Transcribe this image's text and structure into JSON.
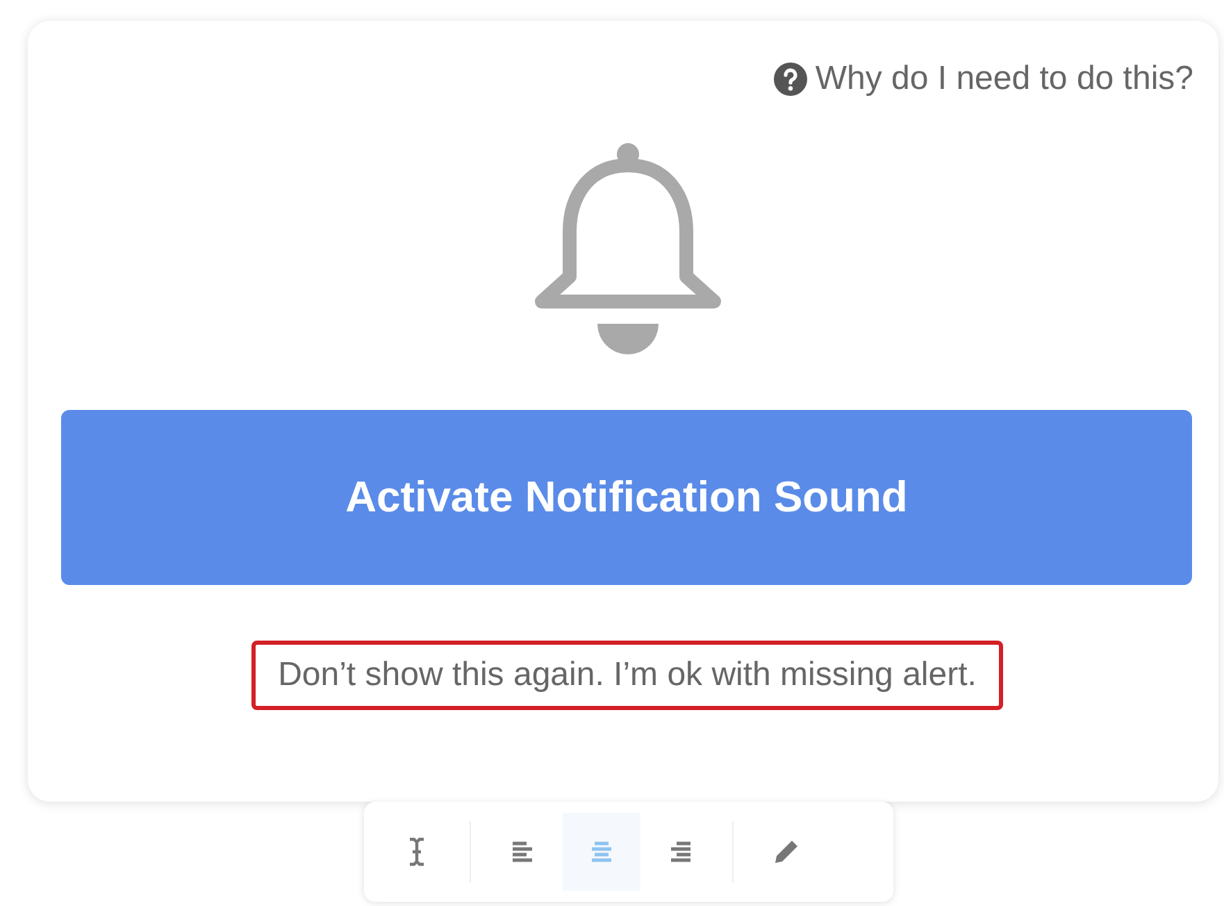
{
  "dialog": {
    "help_link": "Why do I need to do this?",
    "primary_button": "Activate Notification Sound",
    "dismiss_link": {
      "label": "Don’t show this again. I’m ok with missing alert.",
      "highlighted": true
    }
  },
  "toolbar": {
    "tools": [
      {
        "kind": "text-cursor",
        "selected": false
      },
      {
        "kind": "align-left",
        "selected": false
      },
      {
        "kind": "align-center",
        "selected": true
      },
      {
        "kind": "align-right",
        "selected": false
      },
      {
        "kind": "pencil",
        "selected": false
      }
    ]
  }
}
